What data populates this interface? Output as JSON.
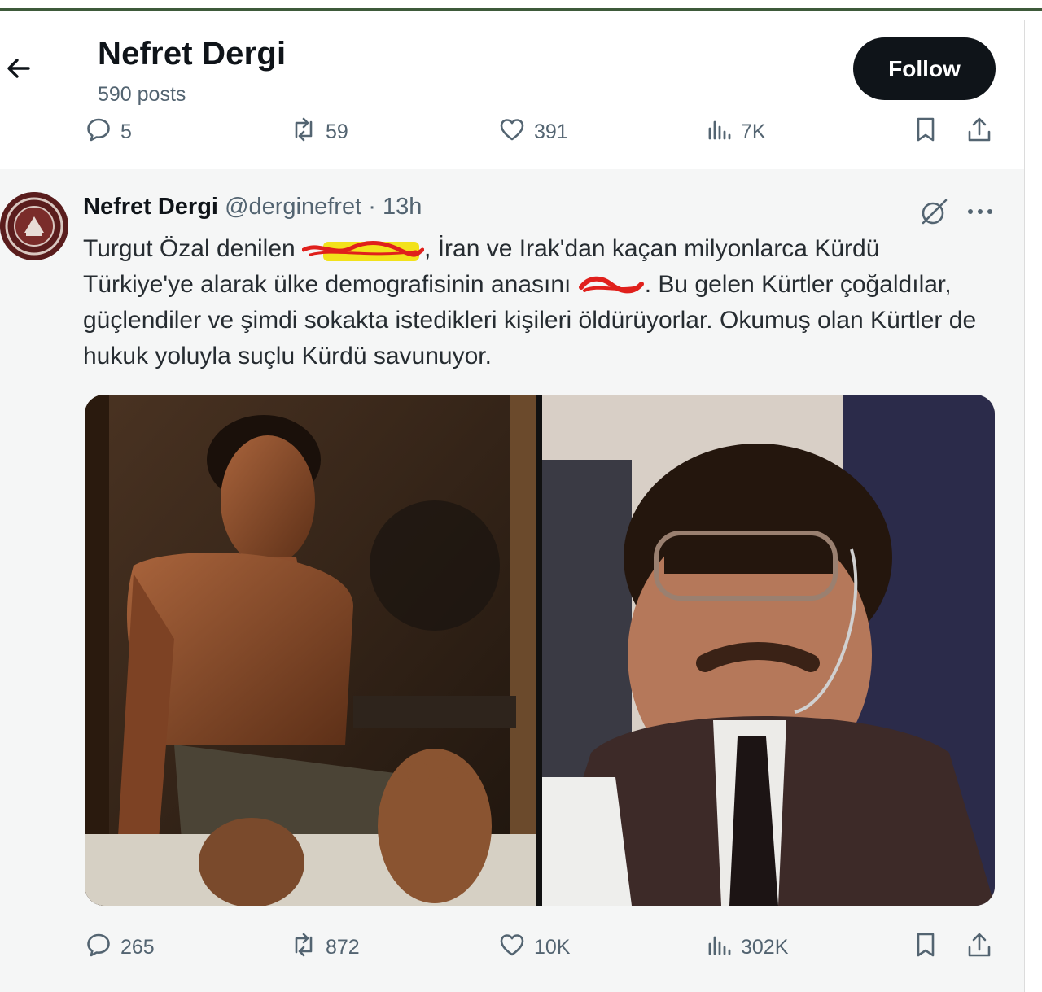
{
  "header": {
    "title": "Nefret Dergi",
    "posts": "590 posts",
    "follow_label": "Follow"
  },
  "top_actions": {
    "replies": "5",
    "reposts": "59",
    "likes": "391",
    "views": "7K"
  },
  "quoted_tweet": {
    "author_name": "Nefret Dergi",
    "handle": "@derginefret",
    "separator": "·",
    "time": "13h",
    "text_part1": "Turgut Özal denilen ",
    "text_part2": ", İran ve Irak'dan kaçan milyonlarca Kürdü Türkiye'ye alarak ülke demografisinin anasını ",
    "text_part3": ". Bu gelen Kürtler çoğaldılar, güçlendiler ve şimdi sokakta istedikleri kişileri öldürüyorlar. Okumuş olan Kürtler de hukuk yoluyla suçlu Kürdü savunuyor.",
    "images": [
      "man-sitting-photo",
      "turgut-ozal-photo"
    ]
  },
  "bottom_actions": {
    "replies": "265",
    "reposts": "872",
    "likes": "10K",
    "views": "302K"
  },
  "colors": {
    "text_primary": "#0f1419",
    "text_secondary": "#536471",
    "follow_bg": "#0f1419",
    "card_bg": "#f5f6f6",
    "top_rule": "#3e5a3a",
    "redaction_red": "#e0201c",
    "highlight_yellow": "#f2e21b"
  }
}
